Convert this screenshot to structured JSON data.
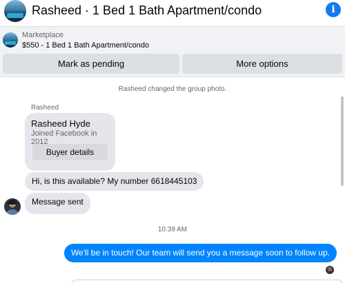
{
  "header": {
    "title": "Rasheed · 1 Bed 1 Bath Apartment/condo",
    "info_icon": "i"
  },
  "marketplace": {
    "label": "Marketplace",
    "item": "$550 - 1 Bed 1 Bath Apartment/condo",
    "mark_pending_label": "Mark as pending",
    "more_options_label": "More options"
  },
  "conversation": {
    "system_message": "Rasheed changed the group photo.",
    "sender_name": "Rasheed",
    "profile_card": {
      "name": "Rasheed Hyde",
      "subtitle": "Joined Facebook in 2012",
      "button_label": "Buyer details"
    },
    "incoming": [
      "Hi, is this available? My number 6618445103",
      "Message sent"
    ],
    "timestamp": "10:39 AM",
    "outgoing": "We'll be in touch! Our team will send you a message soon to follow up."
  },
  "colors": {
    "accent": "#1877f2",
    "outgoing_bubble": "#0084ff",
    "incoming_bubble": "#e4e6eb",
    "bar_background": "#f0f2f5"
  },
  "icons": {
    "info": "info-icon",
    "header_avatar": "listing-photo",
    "sender_avatar": "user-avatar"
  }
}
